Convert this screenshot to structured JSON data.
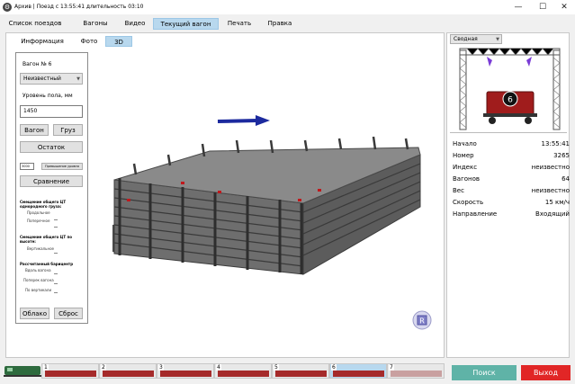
{
  "window": {
    "title": "Архив | Поезд с 13:55:41  длительность  03:10",
    "app_icon_glyph": "⚙"
  },
  "menu": [
    {
      "label": "Список поездов"
    },
    {
      "label": "Вагоны"
    },
    {
      "label": "Видео"
    },
    {
      "label": "Текущий вагон",
      "active": true
    },
    {
      "label": "Печать"
    },
    {
      "label": "Правка"
    }
  ],
  "subtabs": [
    {
      "label": "Информация"
    },
    {
      "label": "Фото"
    },
    {
      "label": "3D",
      "active": true
    }
  ],
  "controls": {
    "wagon_label": "Вагон № 6",
    "type_select": "Неизвестный",
    "floor_label": "Уровень пола, мм",
    "floor_value": "1450",
    "wagon_btn": "Вагон",
    "cargo_btn": "Груз",
    "remainder_btn": "Остаток",
    "exceed_value": "3000",
    "exceed_btn": "Превышение уровня",
    "compare_btn": "Сравнение",
    "shift_uniform_title": "Смещение общего ЦТ однородного груза:",
    "longitudinal": "Продольное",
    "transverse": "Поперечное",
    "shift_height_title": "Смещение общего ЦТ по высоте:",
    "vertical": "Вертикальное",
    "barycenter_title": "Рассчитанный барицентр",
    "along_wagon": "Вдоль вагона",
    "across_wagon": "Поперек вагона",
    "by_vertical": "По вертикали",
    "cloud_btn": "Облако",
    "reset_btn": "Сброс",
    "gizmo_letter": "R"
  },
  "right_panel": {
    "select_value": "Сводная",
    "wagon_badge": "6",
    "info": [
      {
        "key": "Начало",
        "value": "13:55:41"
      },
      {
        "key": "Номер",
        "value": "3265"
      },
      {
        "key": "Индекс",
        "value": "неизвестно"
      },
      {
        "key": "Вагонов",
        "value": "64"
      },
      {
        "key": "Вес",
        "value": "неизвестно"
      },
      {
        "key": "Скорость",
        "value": "15 км/ч"
      },
      {
        "key": "Направление",
        "value": "Входящий"
      }
    ]
  },
  "train_strip": {
    "segments": [
      "1",
      "2",
      "3",
      "4",
      "5",
      "6",
      "7"
    ],
    "selected": "6"
  },
  "buttons": {
    "search": "Поиск",
    "exit": "Выход"
  },
  "colors": {
    "accent": "#b8d8ee",
    "search": "#5fb3a7",
    "exit": "#e12626",
    "wagon_red": "#a52a2a"
  }
}
